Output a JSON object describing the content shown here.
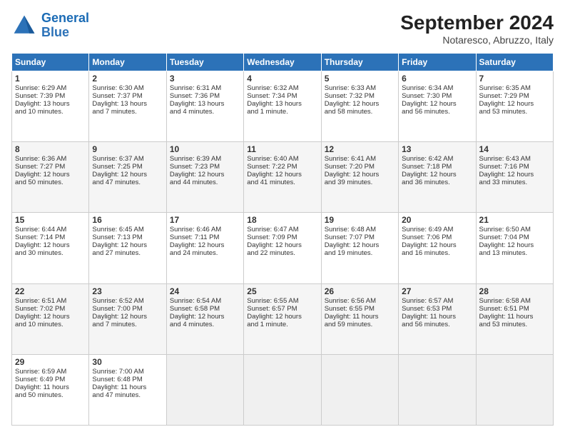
{
  "logo": {
    "line1": "General",
    "line2": "Blue"
  },
  "title": "September 2024",
  "location": "Notaresco, Abruzzo, Italy",
  "headers": [
    "Sunday",
    "Monday",
    "Tuesday",
    "Wednesday",
    "Thursday",
    "Friday",
    "Saturday"
  ],
  "weeks": [
    [
      {
        "day": "1",
        "lines": [
          "Sunrise: 6:29 AM",
          "Sunset: 7:39 PM",
          "Daylight: 13 hours",
          "and 10 minutes."
        ]
      },
      {
        "day": "2",
        "lines": [
          "Sunrise: 6:30 AM",
          "Sunset: 7:37 PM",
          "Daylight: 13 hours",
          "and 7 minutes."
        ]
      },
      {
        "day": "3",
        "lines": [
          "Sunrise: 6:31 AM",
          "Sunset: 7:36 PM",
          "Daylight: 13 hours",
          "and 4 minutes."
        ]
      },
      {
        "day": "4",
        "lines": [
          "Sunrise: 6:32 AM",
          "Sunset: 7:34 PM",
          "Daylight: 13 hours",
          "and 1 minute."
        ]
      },
      {
        "day": "5",
        "lines": [
          "Sunrise: 6:33 AM",
          "Sunset: 7:32 PM",
          "Daylight: 12 hours",
          "and 58 minutes."
        ]
      },
      {
        "day": "6",
        "lines": [
          "Sunrise: 6:34 AM",
          "Sunset: 7:30 PM",
          "Daylight: 12 hours",
          "and 56 minutes."
        ]
      },
      {
        "day": "7",
        "lines": [
          "Sunrise: 6:35 AM",
          "Sunset: 7:29 PM",
          "Daylight: 12 hours",
          "and 53 minutes."
        ]
      }
    ],
    [
      {
        "day": "8",
        "lines": [
          "Sunrise: 6:36 AM",
          "Sunset: 7:27 PM",
          "Daylight: 12 hours",
          "and 50 minutes."
        ]
      },
      {
        "day": "9",
        "lines": [
          "Sunrise: 6:37 AM",
          "Sunset: 7:25 PM",
          "Daylight: 12 hours",
          "and 47 minutes."
        ]
      },
      {
        "day": "10",
        "lines": [
          "Sunrise: 6:39 AM",
          "Sunset: 7:23 PM",
          "Daylight: 12 hours",
          "and 44 minutes."
        ]
      },
      {
        "day": "11",
        "lines": [
          "Sunrise: 6:40 AM",
          "Sunset: 7:22 PM",
          "Daylight: 12 hours",
          "and 41 minutes."
        ]
      },
      {
        "day": "12",
        "lines": [
          "Sunrise: 6:41 AM",
          "Sunset: 7:20 PM",
          "Daylight: 12 hours",
          "and 39 minutes."
        ]
      },
      {
        "day": "13",
        "lines": [
          "Sunrise: 6:42 AM",
          "Sunset: 7:18 PM",
          "Daylight: 12 hours",
          "and 36 minutes."
        ]
      },
      {
        "day": "14",
        "lines": [
          "Sunrise: 6:43 AM",
          "Sunset: 7:16 PM",
          "Daylight: 12 hours",
          "and 33 minutes."
        ]
      }
    ],
    [
      {
        "day": "15",
        "lines": [
          "Sunrise: 6:44 AM",
          "Sunset: 7:14 PM",
          "Daylight: 12 hours",
          "and 30 minutes."
        ]
      },
      {
        "day": "16",
        "lines": [
          "Sunrise: 6:45 AM",
          "Sunset: 7:13 PM",
          "Daylight: 12 hours",
          "and 27 minutes."
        ]
      },
      {
        "day": "17",
        "lines": [
          "Sunrise: 6:46 AM",
          "Sunset: 7:11 PM",
          "Daylight: 12 hours",
          "and 24 minutes."
        ]
      },
      {
        "day": "18",
        "lines": [
          "Sunrise: 6:47 AM",
          "Sunset: 7:09 PM",
          "Daylight: 12 hours",
          "and 22 minutes."
        ]
      },
      {
        "day": "19",
        "lines": [
          "Sunrise: 6:48 AM",
          "Sunset: 7:07 PM",
          "Daylight: 12 hours",
          "and 19 minutes."
        ]
      },
      {
        "day": "20",
        "lines": [
          "Sunrise: 6:49 AM",
          "Sunset: 7:06 PM",
          "Daylight: 12 hours",
          "and 16 minutes."
        ]
      },
      {
        "day": "21",
        "lines": [
          "Sunrise: 6:50 AM",
          "Sunset: 7:04 PM",
          "Daylight: 12 hours",
          "and 13 minutes."
        ]
      }
    ],
    [
      {
        "day": "22",
        "lines": [
          "Sunrise: 6:51 AM",
          "Sunset: 7:02 PM",
          "Daylight: 12 hours",
          "and 10 minutes."
        ]
      },
      {
        "day": "23",
        "lines": [
          "Sunrise: 6:52 AM",
          "Sunset: 7:00 PM",
          "Daylight: 12 hours",
          "and 7 minutes."
        ]
      },
      {
        "day": "24",
        "lines": [
          "Sunrise: 6:54 AM",
          "Sunset: 6:58 PM",
          "Daylight: 12 hours",
          "and 4 minutes."
        ]
      },
      {
        "day": "25",
        "lines": [
          "Sunrise: 6:55 AM",
          "Sunset: 6:57 PM",
          "Daylight: 12 hours",
          "and 1 minute."
        ]
      },
      {
        "day": "26",
        "lines": [
          "Sunrise: 6:56 AM",
          "Sunset: 6:55 PM",
          "Daylight: 11 hours",
          "and 59 minutes."
        ]
      },
      {
        "day": "27",
        "lines": [
          "Sunrise: 6:57 AM",
          "Sunset: 6:53 PM",
          "Daylight: 11 hours",
          "and 56 minutes."
        ]
      },
      {
        "day": "28",
        "lines": [
          "Sunrise: 6:58 AM",
          "Sunset: 6:51 PM",
          "Daylight: 11 hours",
          "and 53 minutes."
        ]
      }
    ],
    [
      {
        "day": "29",
        "lines": [
          "Sunrise: 6:59 AM",
          "Sunset: 6:49 PM",
          "Daylight: 11 hours",
          "and 50 minutes."
        ]
      },
      {
        "day": "30",
        "lines": [
          "Sunrise: 7:00 AM",
          "Sunset: 6:48 PM",
          "Daylight: 11 hours",
          "and 47 minutes."
        ]
      },
      null,
      null,
      null,
      null,
      null
    ]
  ]
}
